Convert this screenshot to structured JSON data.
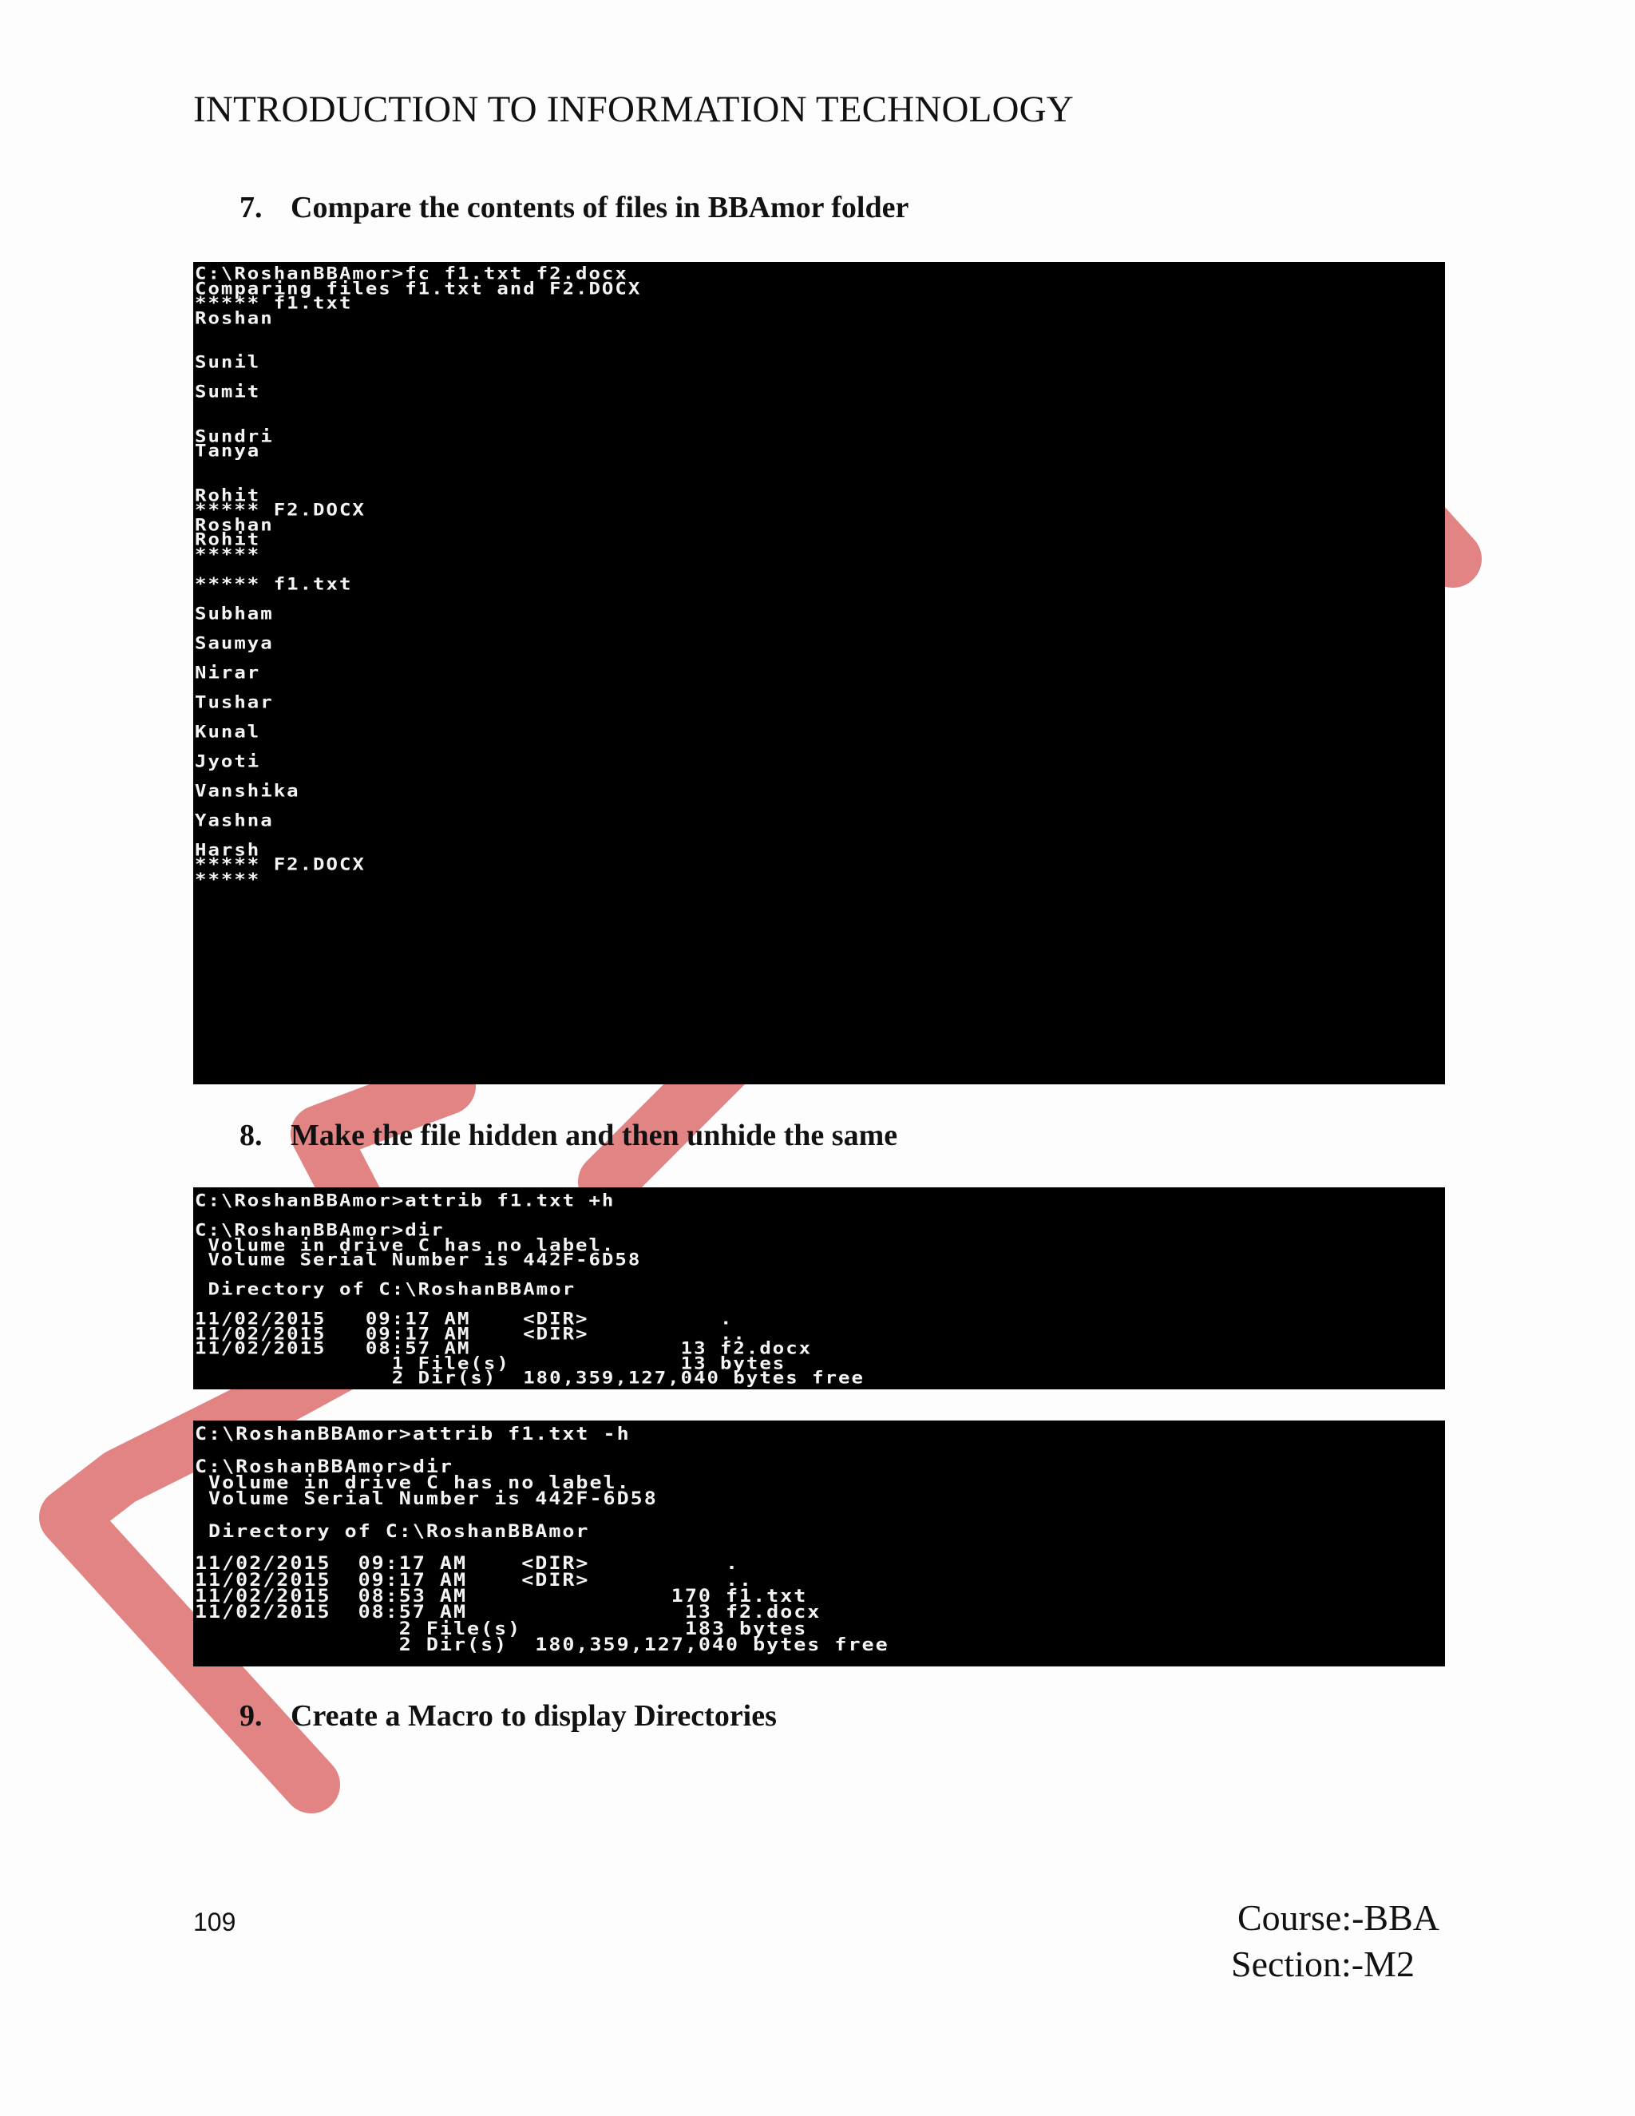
{
  "header": {
    "title": "INTRODUCTION TO INFORMATION TECHNOLOGY"
  },
  "questions": [
    {
      "number": "7.",
      "text": "Compare  the contents of files in BBAmor folder"
    },
    {
      "number": "8.",
      "text": "Make the file hidden  and then unhide  the same"
    },
    {
      "number": "9.",
      "text": "Create a Macro to display Directories"
    }
  ],
  "terminal_compare": {
    "lines": [
      "C:\\RoshanBBAmor>fc f1.txt f2.docx",
      "Comparing files f1.txt and F2.DOCX",
      "***** f1.txt",
      "Roshan",
      "",
      "",
      "Sunil",
      "",
      "Sumit",
      "",
      "",
      "Sundri",
      "Tanya",
      "",
      "",
      "Rohit",
      "***** F2.DOCX",
      "Roshan",
      "Rohit",
      "*****",
      "",
      "***** f1.txt",
      "",
      "Subham",
      "",
      "Saumya",
      "",
      "Nirar",
      "",
      "Tushar",
      "",
      "Kunal",
      "",
      "Jyoti",
      "",
      "Vanshika",
      "",
      "Yashna",
      "",
      "Harsh",
      "***** F2.DOCX",
      "*****"
    ]
  },
  "terminal_hide": {
    "lines": [
      "C:\\RoshanBBAmor>attrib f1.txt +h",
      "",
      "C:\\RoshanBBAmor>dir",
      " Volume in drive C has no label.",
      " Volume Serial Number is 442F-6D58",
      "",
      " Directory of C:\\RoshanBBAmor",
      "",
      "11/02/2015   09:17 AM    <DIR>          .",
      "11/02/2015   09:17 AM    <DIR>          ..",
      "11/02/2015   08:57 AM                13 f2.docx",
      "               1 File(s)             13 bytes",
      "               2 Dir(s)  180,359,127,040 bytes free"
    ]
  },
  "terminal_unhide": {
    "lines": [
      "C:\\RoshanBBAmor>attrib f1.txt -h",
      "",
      "C:\\RoshanBBAmor>dir",
      " Volume in drive C has no label.",
      " Volume Serial Number is 442F-6D58",
      "",
      " Directory of C:\\RoshanBBAmor",
      "",
      "11/02/2015  09:17 AM    <DIR>          .",
      "11/02/2015  09:17 AM    <DIR>          ..",
      "11/02/2015  08:53 AM               170 f1.txt",
      "11/02/2015  08:57 AM                13 f2.docx",
      "               2 File(s)            183 bytes",
      "               2 Dir(s)  180,359,127,040 bytes free"
    ]
  },
  "footer": {
    "page_number": "109",
    "course": "Course:-BBA",
    "section": "Section:-M2"
  }
}
